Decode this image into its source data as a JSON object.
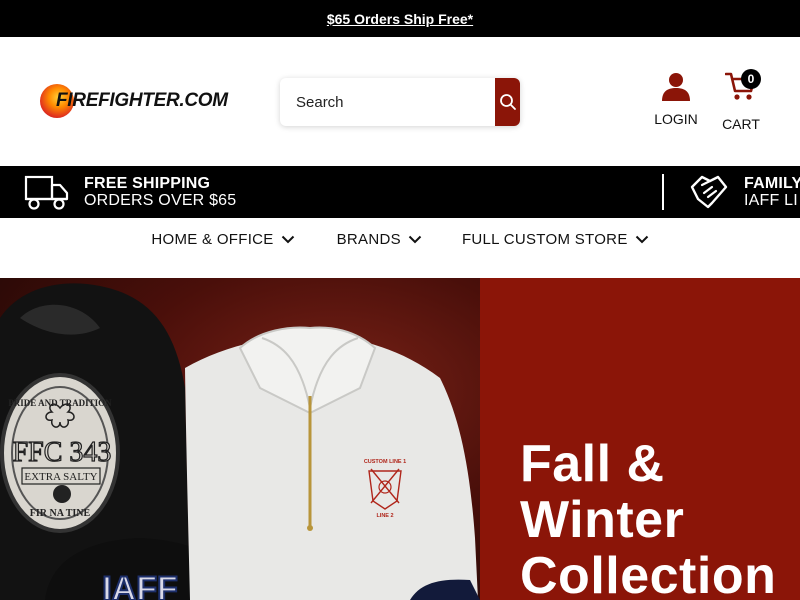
{
  "promo": {
    "text": "$65 Orders Ship Free*"
  },
  "header": {
    "logo": {
      "text_main": "FIREFIGHTER",
      "text_suffix": ".COM"
    },
    "search": {
      "placeholder": "Search",
      "value": "",
      "button_icon": "search-icon"
    },
    "login": {
      "label": "LOGIN",
      "icon": "user-icon"
    },
    "cart": {
      "label": "CART",
      "count": "0",
      "icon": "cart-icon"
    }
  },
  "benefits": [
    {
      "icon": "truck-icon",
      "line1": "FREE SHIPPING",
      "line2": "ORDERS OVER $65"
    },
    {
      "icon": "handshake-icon",
      "line1": "FAMILY",
      "line2": "IAFF LI"
    }
  ],
  "nav": {
    "items": [
      {
        "label": "HOME & OFFICE",
        "icon": "chevron-down-icon"
      },
      {
        "label": "BRANDS",
        "icon": "chevron-down-icon"
      },
      {
        "label": "FULL CUSTOM STORE",
        "icon": "chevron-down-icon"
      }
    ]
  },
  "hero": {
    "title": "Fall &\nWinter\nCollection",
    "patch_lines": [
      "PRIDE AND TRADITION",
      "FFC 343",
      "EXTRA SALTY",
      "FIR NA TINE"
    ],
    "embroidery_lines": [
      "CUSTOM LINE 1",
      "LINE 2"
    ],
    "tee_text": "IAFF"
  },
  "colors": {
    "brand_red": "#8b1508",
    "promo_bg": "#000000",
    "text": "#111111"
  }
}
